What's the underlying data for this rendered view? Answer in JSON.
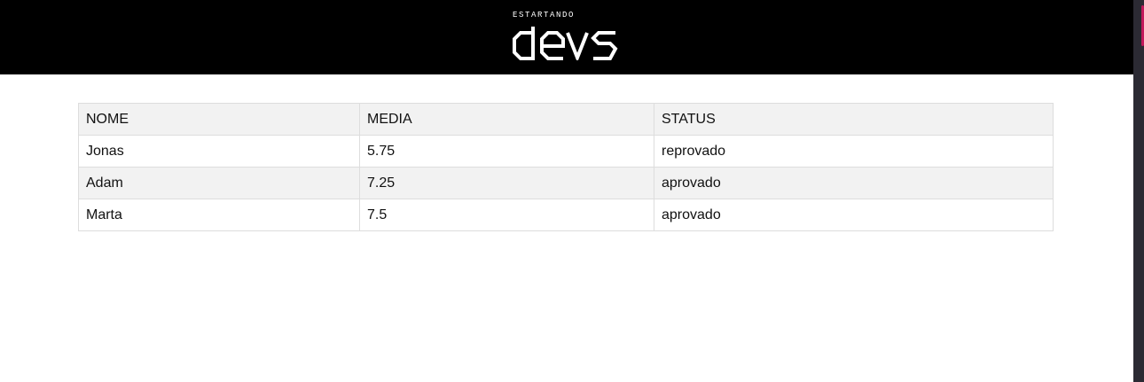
{
  "header": {
    "logo_small": "ESTARTANDO",
    "logo_word": "devs"
  },
  "colors": {
    "header_bg": "#000000",
    "row_alt_bg": "#f2f2f2",
    "scroll_accent": "#c2185b"
  },
  "table": {
    "columns": [
      "NOME",
      "MEDIA",
      "STATUS"
    ],
    "rows": [
      {
        "nome": "Jonas",
        "media": "5.75",
        "status": "reprovado"
      },
      {
        "nome": "Adam",
        "media": "7.25",
        "status": "aprovado"
      },
      {
        "nome": "Marta",
        "media": "7.5",
        "status": "aprovado"
      }
    ]
  }
}
